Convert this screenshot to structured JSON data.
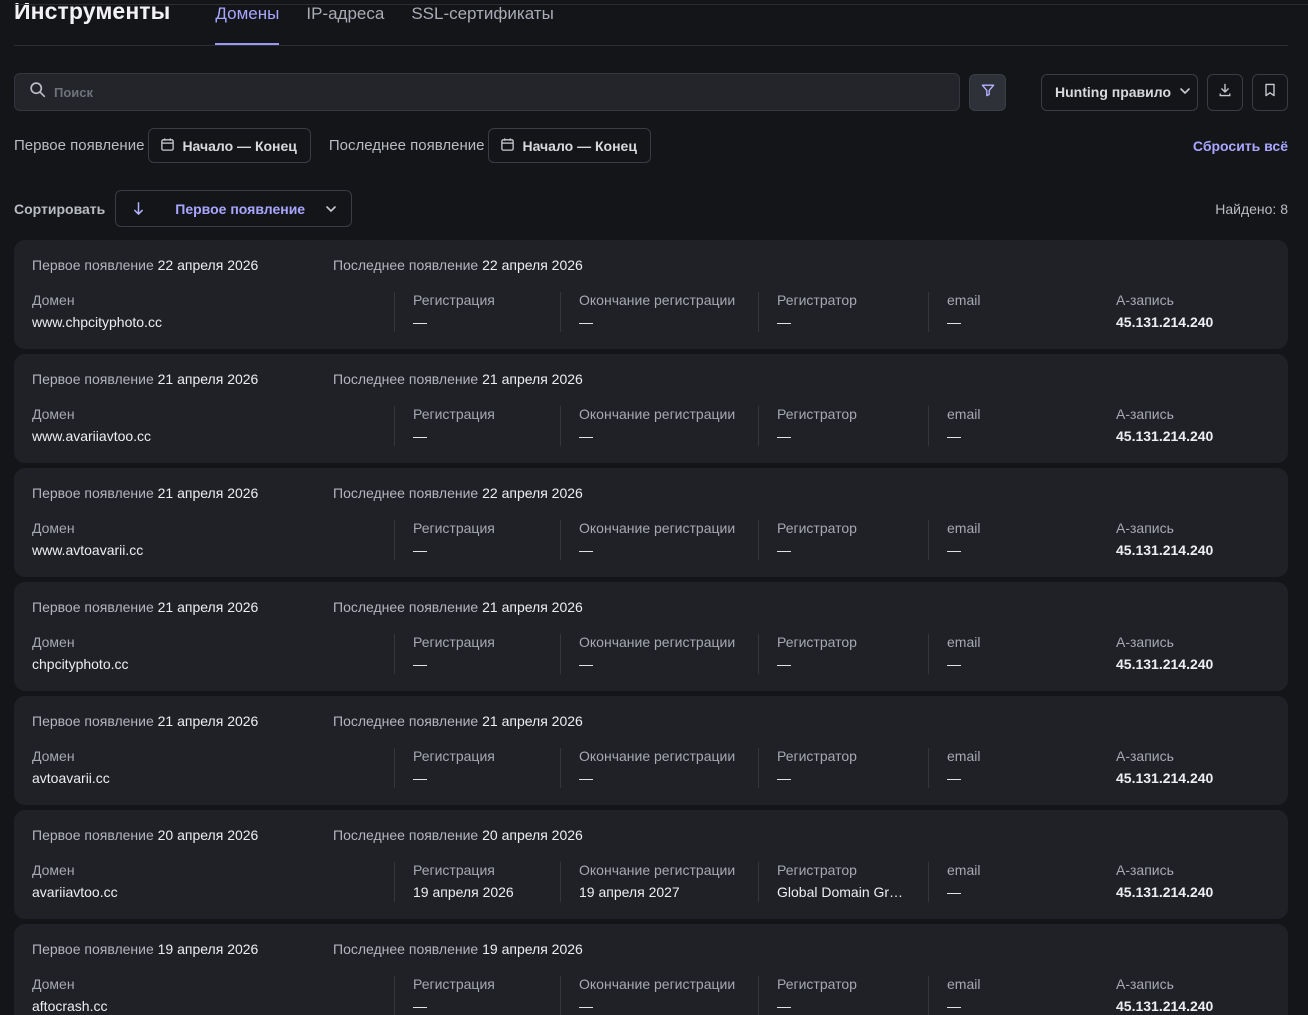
{
  "header": {
    "title": "Инструменты",
    "tabs": [
      {
        "label": "Домены",
        "active": true
      },
      {
        "label": "IP-адреса",
        "active": false
      },
      {
        "label": "SSL-сертификаты",
        "active": false
      }
    ]
  },
  "search": {
    "placeholder": "Поиск",
    "value": ""
  },
  "toolbar": {
    "hunting_label": "Hunting правило"
  },
  "filters": {
    "first_seen_label": "Первое появление",
    "first_seen_value": "Начало — Конец",
    "last_seen_label": "Последнее появление",
    "last_seen_value": "Начало — Конец",
    "reset_label": "Сбросить всё"
  },
  "sort": {
    "label": "Сортировать",
    "selected": "Первое появление",
    "found_text": "Найдено: 8"
  },
  "card_labels": {
    "first_seen": "Первое появление",
    "last_seen": "Последнее появление",
    "domain": "Домен",
    "registration": "Регистрация",
    "expiration": "Окончание регистрации",
    "registrar": "Регистратор",
    "email": "email",
    "a_record": "A-запись"
  },
  "records": [
    {
      "first_seen": "22 апреля 2026",
      "last_seen": "22 апреля 2026",
      "domain": "www.chpcityphoto.cc",
      "registration": "—",
      "expiration": "—",
      "registrar": "—",
      "email": "—",
      "a_record": "45.131.214.240"
    },
    {
      "first_seen": "21 апреля 2026",
      "last_seen": "21 апреля 2026",
      "domain": "www.avariiavtoo.cc",
      "registration": "—",
      "expiration": "—",
      "registrar": "—",
      "email": "—",
      "a_record": "45.131.214.240"
    },
    {
      "first_seen": "21 апреля 2026",
      "last_seen": "22 апреля 2026",
      "domain": "www.avtoavarii.cc",
      "registration": "—",
      "expiration": "—",
      "registrar": "—",
      "email": "—",
      "a_record": "45.131.214.240"
    },
    {
      "first_seen": "21 апреля 2026",
      "last_seen": "21 апреля 2026",
      "domain": "chpcityphoto.cc",
      "registration": "—",
      "expiration": "—",
      "registrar": "—",
      "email": "—",
      "a_record": "45.131.214.240"
    },
    {
      "first_seen": "21 апреля 2026",
      "last_seen": "21 апреля 2026",
      "domain": "avtoavarii.cc",
      "registration": "—",
      "expiration": "—",
      "registrar": "—",
      "email": "—",
      "a_record": "45.131.214.240"
    },
    {
      "first_seen": "20 апреля 2026",
      "last_seen": "20 апреля 2026",
      "domain": "avariiavtoo.cc",
      "registration": "19 апреля 2026",
      "expiration": "19 апреля 2027",
      "registrar": "Global Domain Group LLC",
      "email": "—",
      "a_record": "45.131.214.240"
    },
    {
      "first_seen": "19 апреля 2026",
      "last_seen": "19 апреля 2026",
      "domain": "aftocrash.cc",
      "registration": "—",
      "expiration": "—",
      "registrar": "—",
      "email": "—",
      "a_record": "45.131.214.240"
    }
  ],
  "colors": {
    "accent": "#a9a6ff",
    "background": "#141519",
    "card": "#202126"
  }
}
